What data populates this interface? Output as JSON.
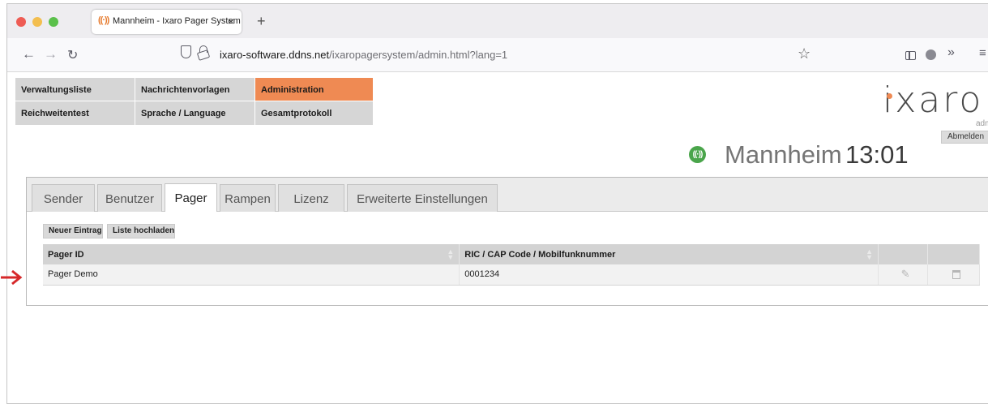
{
  "browser": {
    "tab_icon": "((·))",
    "tab_title": "Mannheim - Ixaro Pager System",
    "tab_close": "×",
    "new_tab": "+",
    "url_host": "ixaro-software.ddns.net",
    "url_path": "/ixaropagersystem/admin.html?lang=1"
  },
  "menu": {
    "items": [
      {
        "label": "Verwaltungsliste"
      },
      {
        "label": "Nachrichtenvorlagen"
      },
      {
        "label": "Administration"
      },
      {
        "label": "Reichweitentest"
      },
      {
        "label": "Sprache / Language"
      },
      {
        "label": "Gesamtprotokoll"
      }
    ],
    "active_color": "#ef8a53"
  },
  "logo": {
    "text": "ixaro"
  },
  "user": {
    "role": "admin",
    "logout_label": "Abmelden"
  },
  "status": {
    "icon": "((·))",
    "location": "Mannheim",
    "time": "13:01",
    "icon_color": "#4aa54b"
  },
  "tabs": [
    {
      "label": "Sender"
    },
    {
      "label": "Benutzer"
    },
    {
      "label": "Pager"
    },
    {
      "label": "Rampen"
    },
    {
      "label": "Lizenz"
    },
    {
      "label": "Erweiterte Einstellungen"
    }
  ],
  "actions": {
    "new_entry": "Neuer Eintrag",
    "upload_list": "Liste hochladen"
  },
  "table": {
    "columns": [
      "Pager ID",
      "RIC / CAP Code / Mobilfunknummer"
    ],
    "rows": [
      {
        "pager_id": "Pager Demo",
        "ric": "0001234"
      }
    ]
  },
  "annotation": {
    "arrow_color": "#d6282a"
  }
}
